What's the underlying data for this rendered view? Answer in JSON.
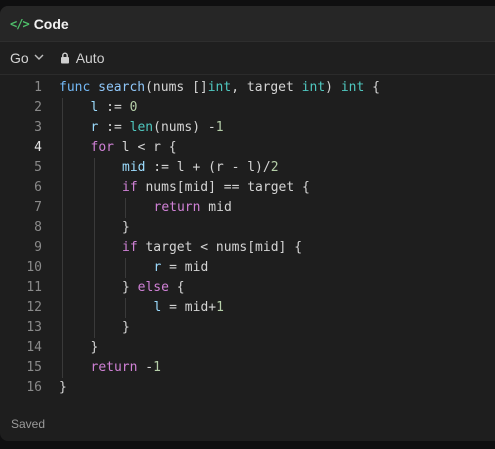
{
  "header": {
    "title": "Code",
    "icon": "code-icon"
  },
  "toolbar": {
    "language": "Go",
    "mode": "Auto"
  },
  "editor": {
    "active_line": 4,
    "lines": [
      {
        "num": "1",
        "indent": 0,
        "tokens": [
          [
            "kw2",
            "func"
          ],
          [
            "",
            " "
          ],
          [
            "fn",
            "search"
          ],
          [
            "",
            "(nums []"
          ],
          [
            "ty",
            "int"
          ],
          [
            "",
            ", target "
          ],
          [
            "ty",
            "int"
          ],
          [
            "",
            ") "
          ],
          [
            "ty",
            "int"
          ],
          [
            "",
            " {"
          ]
        ]
      },
      {
        "num": "2",
        "indent": 1,
        "tokens": [
          [
            "var",
            "l"
          ],
          [
            "",
            " := "
          ],
          [
            "num",
            "0"
          ]
        ]
      },
      {
        "num": "3",
        "indent": 1,
        "tokens": [
          [
            "var",
            "r"
          ],
          [
            "",
            " := "
          ],
          [
            "ty",
            "len"
          ],
          [
            "",
            "(nums) -"
          ],
          [
            "num",
            "1"
          ]
        ]
      },
      {
        "num": "4",
        "indent": 1,
        "tokens": [
          [
            "kw",
            "for"
          ],
          [
            "",
            " l < r {"
          ]
        ]
      },
      {
        "num": "5",
        "indent": 2,
        "tokens": [
          [
            "var",
            "mid"
          ],
          [
            "",
            " := l + (r - l)/"
          ],
          [
            "num",
            "2"
          ]
        ]
      },
      {
        "num": "6",
        "indent": 2,
        "tokens": [
          [
            "kw",
            "if"
          ],
          [
            "",
            " nums[mid] == target {"
          ]
        ]
      },
      {
        "num": "7",
        "indent": 3,
        "tokens": [
          [
            "kw",
            "return"
          ],
          [
            "",
            " mid"
          ]
        ]
      },
      {
        "num": "8",
        "indent": 2,
        "tokens": [
          [
            "",
            "}"
          ]
        ]
      },
      {
        "num": "9",
        "indent": 2,
        "tokens": [
          [
            "kw",
            "if"
          ],
          [
            "",
            " target < nums[mid] {"
          ]
        ]
      },
      {
        "num": "10",
        "indent": 3,
        "tokens": [
          [
            "var",
            "r"
          ],
          [
            "",
            " = mid"
          ]
        ]
      },
      {
        "num": "11",
        "indent": 2,
        "tokens": [
          [
            "",
            "} "
          ],
          [
            "kw",
            "else"
          ],
          [
            "",
            " {"
          ]
        ]
      },
      {
        "num": "12",
        "indent": 3,
        "tokens": [
          [
            "var",
            "l"
          ],
          [
            "",
            " = mid+"
          ],
          [
            "num",
            "1"
          ]
        ]
      },
      {
        "num": "13",
        "indent": 2,
        "tokens": [
          [
            "",
            "}"
          ]
        ]
      },
      {
        "num": "14",
        "indent": 1,
        "tokens": [
          [
            "",
            "}"
          ]
        ]
      },
      {
        "num": "15",
        "indent": 1,
        "tokens": [
          [
            "kw",
            "return"
          ],
          [
            "",
            " -"
          ],
          [
            "num",
            "1"
          ]
        ]
      },
      {
        "num": "16",
        "indent": 0,
        "tokens": [
          [
            "",
            "}"
          ]
        ]
      }
    ]
  },
  "status": {
    "text": "Saved"
  }
}
